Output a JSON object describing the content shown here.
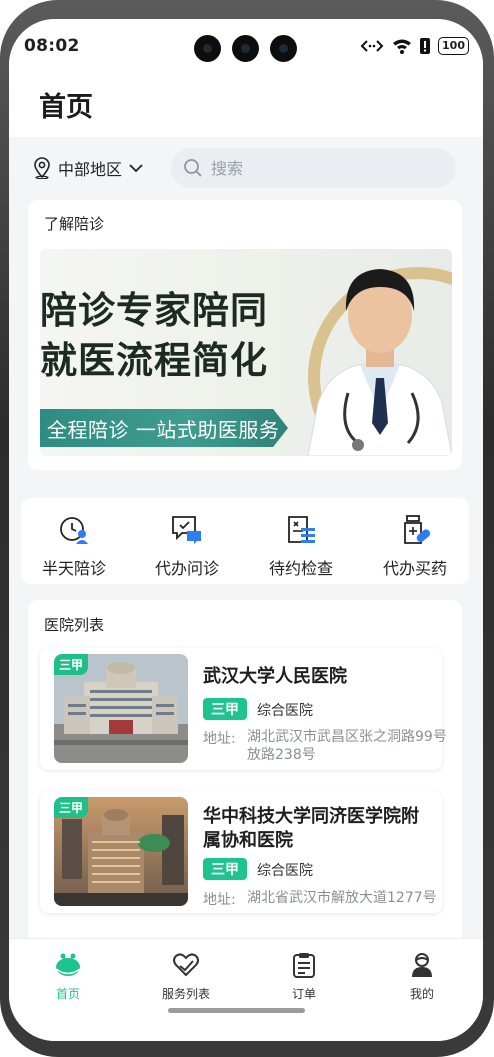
{
  "status_bar": {
    "time": "08:02",
    "battery": "100"
  },
  "header": {
    "title": "首页"
  },
  "location": {
    "label": "中部地区"
  },
  "search": {
    "placeholder": "搜索"
  },
  "intro": {
    "title": "了解陪诊"
  },
  "banner": {
    "headline_line1": "陪诊专家陪同",
    "headline_line2": "就医流程简化",
    "subtitle": "全程陪诊 一站式助医服务"
  },
  "services": [
    {
      "label": "半天陪诊",
      "icon": "clock-person-icon"
    },
    {
      "label": "代办问诊",
      "icon": "chat-medical-icon"
    },
    {
      "label": "待约检查",
      "icon": "checklist-icon"
    },
    {
      "label": "代办买药",
      "icon": "medicine-bottle-icon"
    }
  ],
  "hospital_list": {
    "title": "医院列表",
    "items": [
      {
        "image_badge": "三甲",
        "name": "武汉大学人民医院",
        "grade": "三甲",
        "type": "综合医院",
        "address_label": "地址:",
        "address": "湖北武汉市武昌区张之洞路99号放路238号"
      },
      {
        "image_badge": "三甲",
        "name": "华中科技大学同济医学院附属协和医院",
        "grade": "三甲",
        "type": "综合医院",
        "address_label": "地址:",
        "address": "湖北省武汉市解放大道1277号"
      }
    ]
  },
  "tabbar": {
    "items": [
      {
        "label": "首页",
        "icon": "home-icon",
        "active": true
      },
      {
        "label": "服务列表",
        "icon": "heart-hands-icon",
        "active": false
      },
      {
        "label": "订单",
        "icon": "clipboard-icon",
        "active": false
      },
      {
        "label": "我的",
        "icon": "user-icon",
        "active": false
      }
    ]
  },
  "colors": {
    "accent": "#1ec48f",
    "ribbon": "#2f8c82",
    "page_bg": "#f4f5f7",
    "icon_blue": "#2f7cf6"
  }
}
